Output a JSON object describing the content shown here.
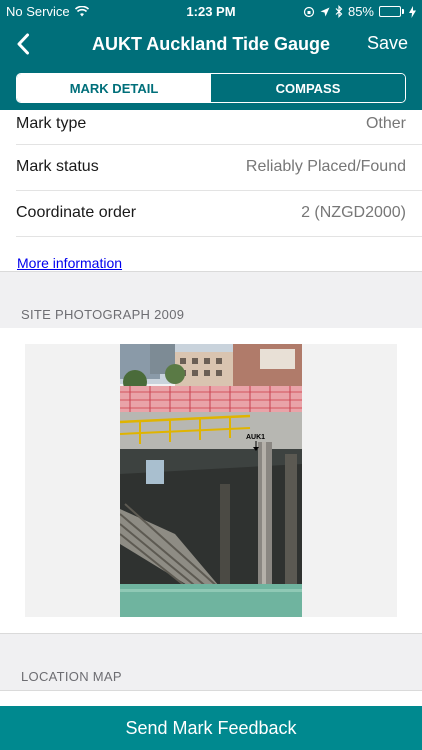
{
  "status_bar": {
    "carrier": "No Service",
    "time": "1:23 PM",
    "battery": "85%",
    "battery_level": 0.85
  },
  "nav": {
    "title": "AUKT Auckland Tide Gauge",
    "save_label": "Save"
  },
  "tabs": [
    {
      "label": "MARK DETAIL",
      "active": true
    },
    {
      "label": "COMPASS",
      "active": false
    }
  ],
  "details": [
    {
      "label": "Mark type",
      "value": "Other"
    },
    {
      "label": "Mark status",
      "value": "Reliably Placed/Found"
    },
    {
      "label": "Coordinate order",
      "value": "2 (NZGD2000)"
    }
  ],
  "more_info_label": "More information",
  "photo_section": {
    "header": "SITE PHOTOGRAPH 2009",
    "photo_annotation": "AUK1"
  },
  "map_section": {
    "header": "LOCATION MAP"
  },
  "footer": {
    "button_label": "Send Mark Feedback"
  },
  "colors": {
    "bar": "#006f7a",
    "footer": "#00898f",
    "battery_fill": "#7ed321"
  }
}
